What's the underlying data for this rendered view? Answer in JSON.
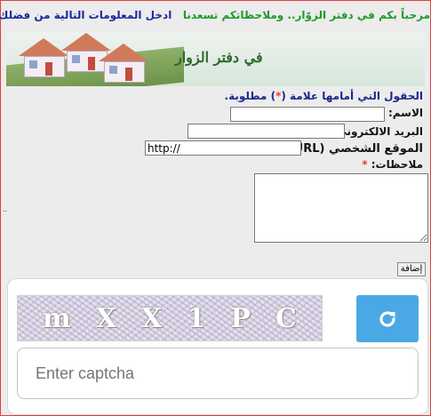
{
  "header": {
    "welcome_text": "مرحباً بكم في دفتر الزوّار.. وملاحظاتكم تسعدنا",
    "instruction_text": "ادخل المعلومات التالية من فضلك",
    "welcome_color": "#1e9a2a",
    "instruction_color": "#1a2a9a"
  },
  "banner": {
    "title": "في دفتر الزوار"
  },
  "form": {
    "required_note_before": "الحقول التي أمامها علامة (",
    "required_note_star": "*",
    "required_note_after": ") مطلوبة.",
    "name_label": "الاسم:",
    "name_required": "*",
    "name_value": "",
    "email_label": "البريد الالكتروني:",
    "email_value": "",
    "website_label": "الموقع الشخصي (URL):",
    "website_value": "http://",
    "comments_label": "ملاحظات:",
    "comments_required": "*",
    "comments_value": "",
    "submit_label": "إضافة"
  },
  "captcha": {
    "characters": [
      "m",
      "X",
      "X",
      "1",
      "P",
      "C"
    ],
    "input_placeholder": "Enter captcha",
    "refresh_icon": "refresh-icon",
    "refresh_color": "#4aa9e4"
  }
}
